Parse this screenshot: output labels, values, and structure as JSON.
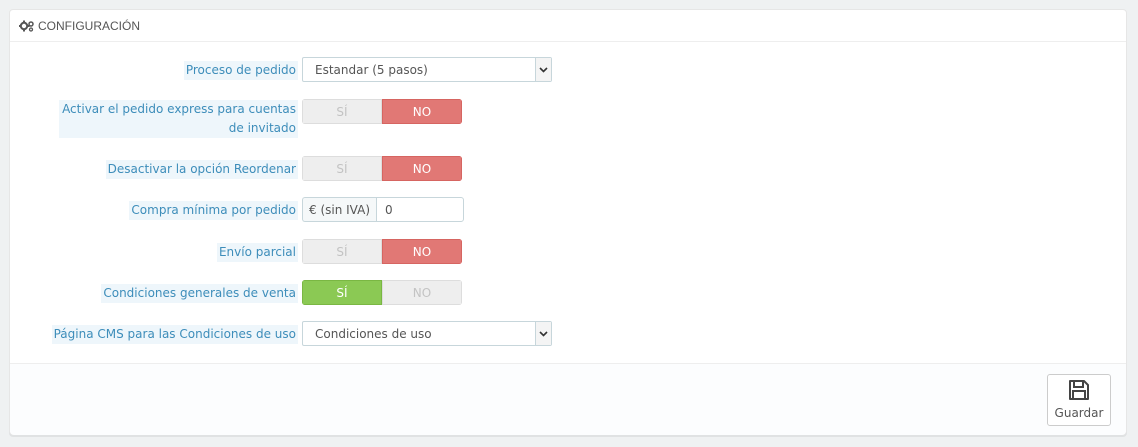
{
  "panel": {
    "title": "Configuración",
    "heading_icon": "cogs-icon"
  },
  "fields": {
    "order_process": {
      "label": "Proceso de pedido",
      "selected": "Estandar (5 pasos)"
    },
    "guest_checkout": {
      "label_line1": "Activar el pedido express para cuentas",
      "label_line2": "de invitado",
      "yes": "SÍ",
      "no": "NO",
      "value": "no"
    },
    "disable_reorder": {
      "label": "Desactivar la opción Reordenar",
      "yes": "SÍ",
      "no": "NO",
      "value": "no"
    },
    "min_purchase": {
      "label": "Compra mínima por pedido",
      "addon": "€ (sin IVA)",
      "value": "0"
    },
    "partial_shipping": {
      "label": "Envío parcial",
      "yes": "SÍ",
      "no": "NO",
      "value": "no"
    },
    "terms": {
      "label": "Condiciones generales de venta",
      "yes": "SÍ",
      "no": "NO",
      "value": "yes"
    },
    "cms_page": {
      "label": "Página CMS para las Condiciones de uso",
      "selected": "Condiciones de uso"
    }
  },
  "footer": {
    "save_label": "Guardar",
    "save_icon": "floppy-disk-icon"
  },
  "colors": {
    "label": "#3d8dba",
    "no_active": "#e17875",
    "yes_active": "#8bc954",
    "off": "#eeeeee"
  }
}
